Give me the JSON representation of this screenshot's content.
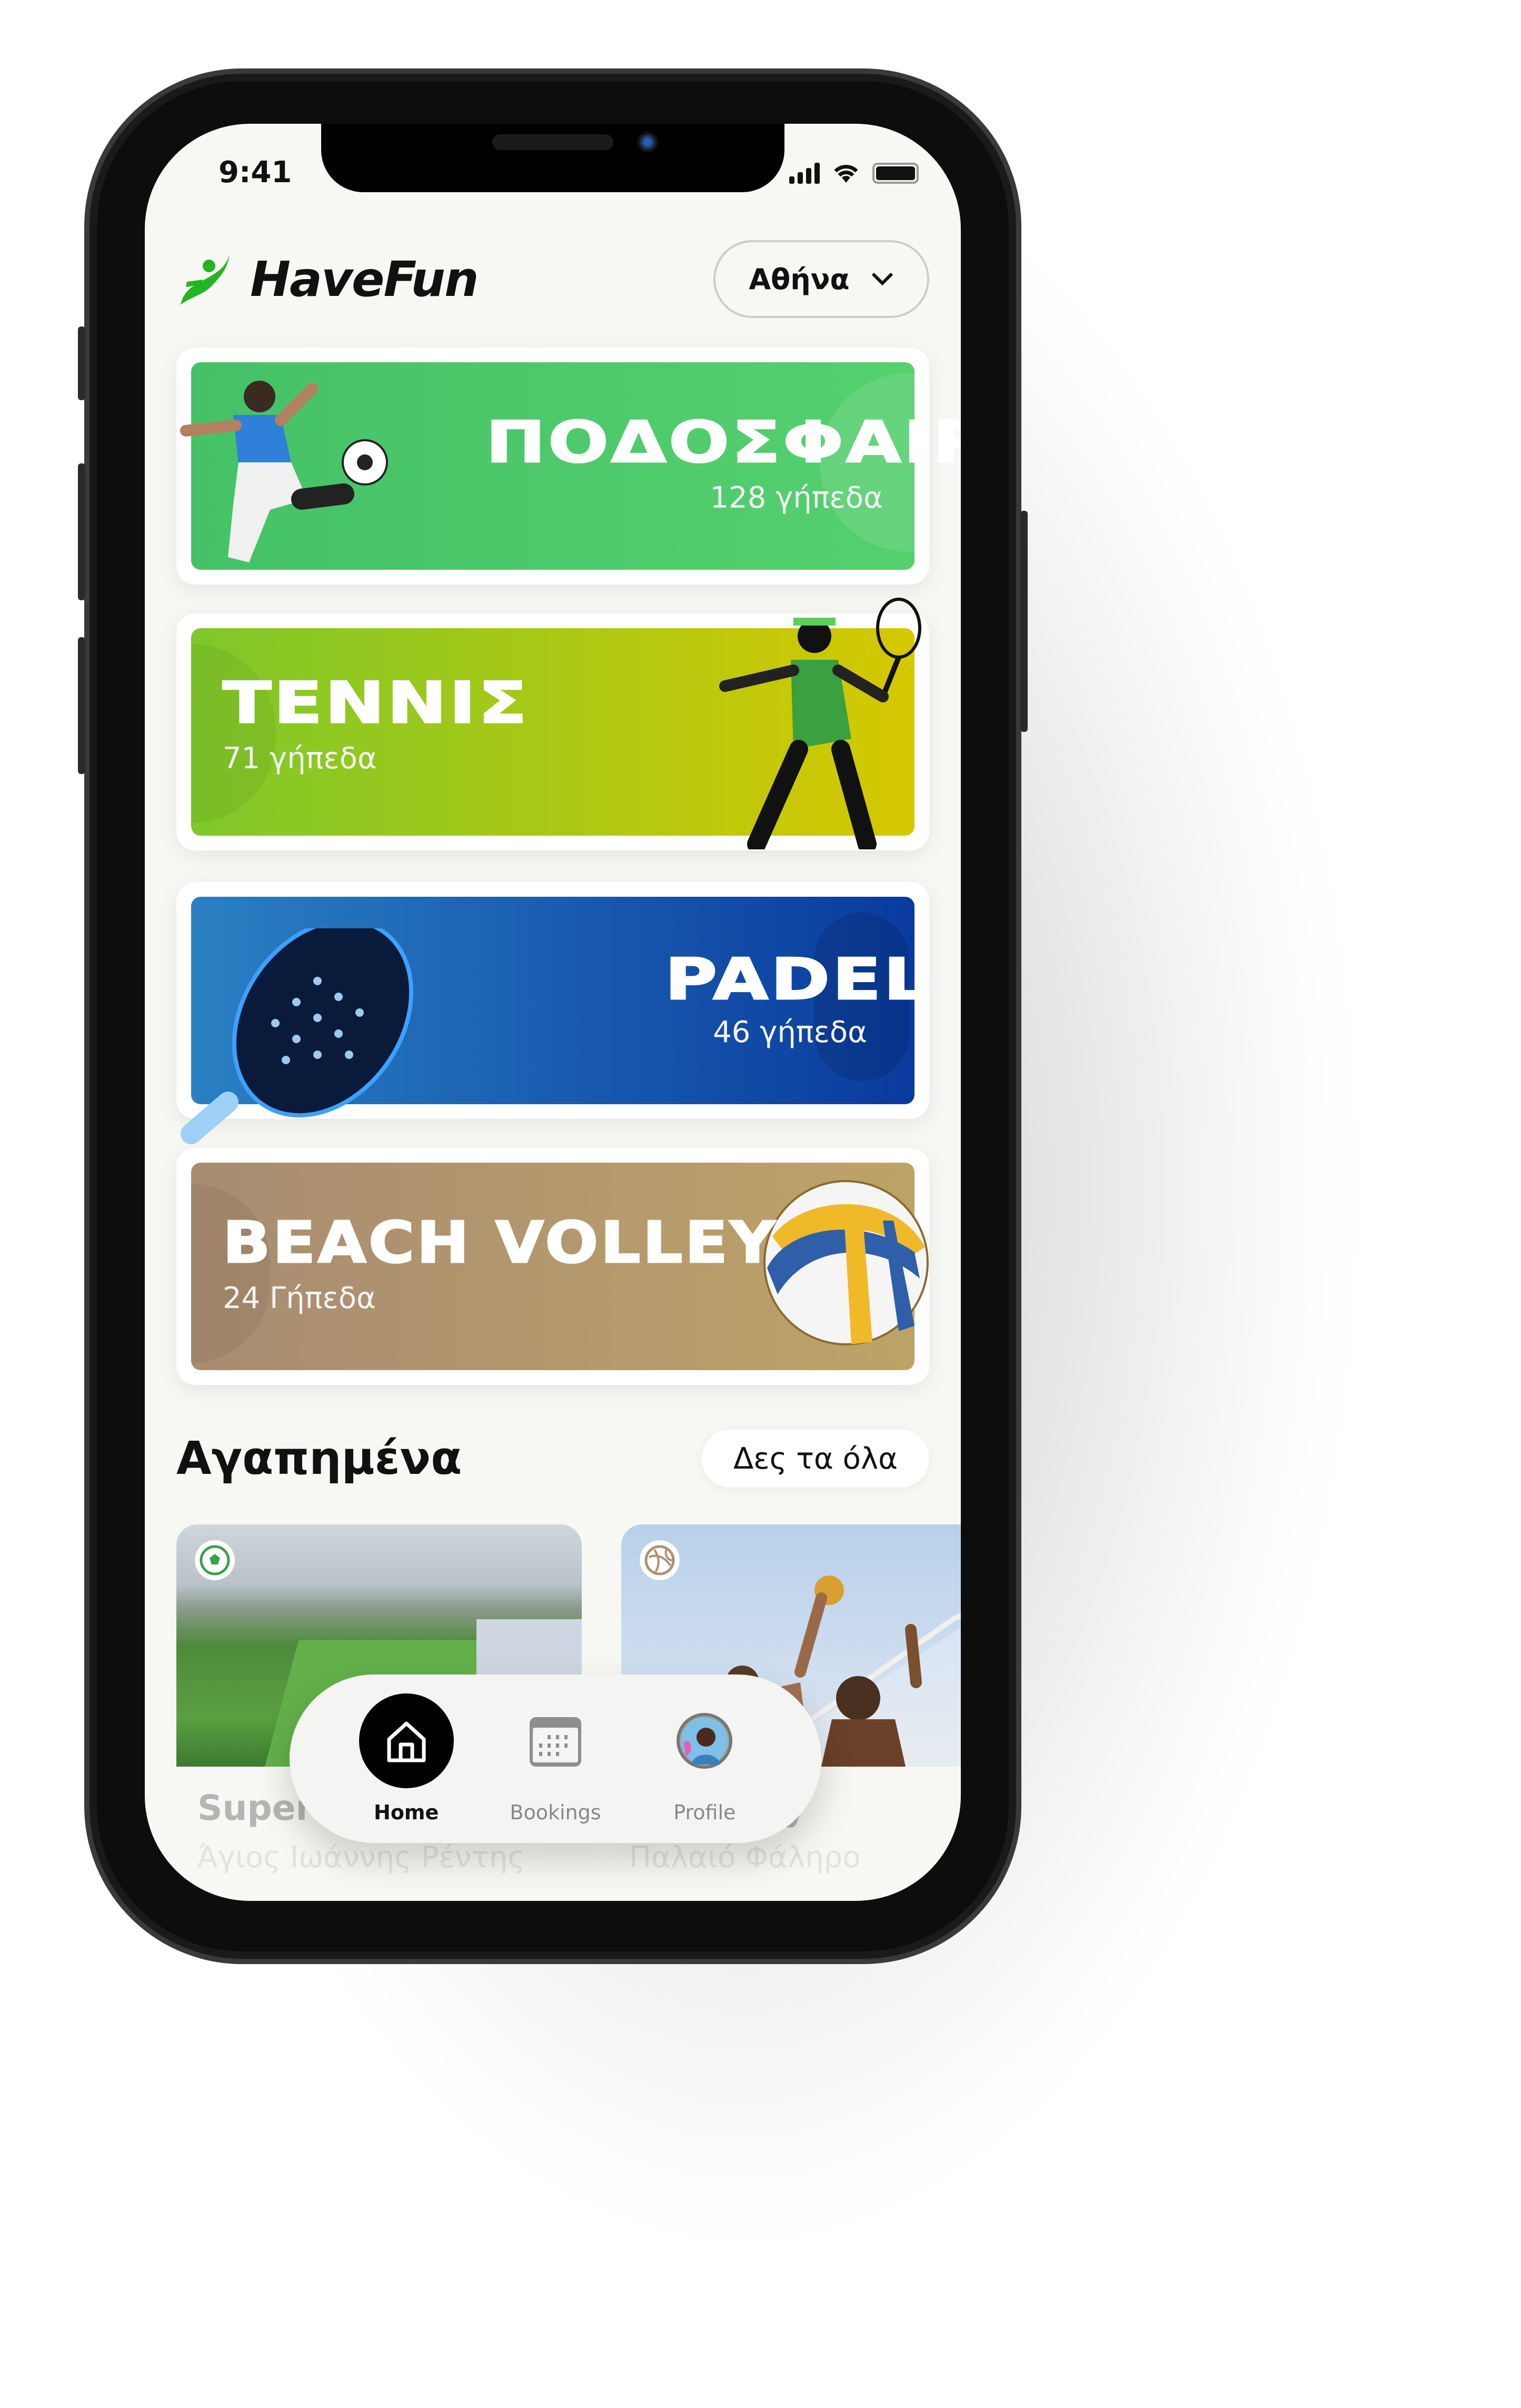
{
  "status_bar": {
    "time": "9:41"
  },
  "header": {
    "app_name": "HaveFun",
    "city_selector": {
      "selected": "Αθήνα"
    }
  },
  "sports": [
    {
      "title": "ΠΟΔΟΣΦΑΙΡΟ",
      "count": "128 γήπεδα",
      "colors": [
        "#45c267",
        "#55d06f"
      ]
    },
    {
      "title": "ΤΕΝΝΙΣ",
      "count": "71 γήπεδα",
      "colors": [
        "#7ec82a",
        "#d6c800"
      ]
    },
    {
      "title": "PADEL",
      "count": "46 γήπεδα",
      "colors": [
        "#2a80c2",
        "#0a3a9e"
      ]
    },
    {
      "title": "BEACH VOLLEY",
      "count": "24 Γήπεδα",
      "colors": [
        "#a88c72",
        "#bea368"
      ]
    }
  ],
  "favorites": {
    "title": "Αγαπημένα",
    "see_all": "Δες τα όλα",
    "items": [
      {
        "name": "Super S",
        "location": "Άγιος Ιωάννης Ρέντης",
        "sport_icon": "soccer-ball-icon"
      },
      {
        "name": "ay",
        "location": "Παλαιό Φάληρο",
        "sport_icon": "volleyball-icon"
      }
    ]
  },
  "bottom_nav": {
    "items": [
      {
        "label": "Home",
        "icon": "home-icon",
        "active": true
      },
      {
        "label": "Bookings",
        "icon": "calendar-icon",
        "active": false
      },
      {
        "label": "Profile",
        "icon": "avatar-icon",
        "active": false
      }
    ]
  },
  "colors": {
    "brand_green": "#22b522",
    "background": "#f7f7f3"
  }
}
